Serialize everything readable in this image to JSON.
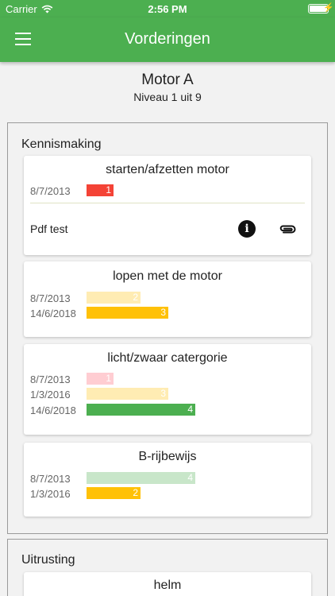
{
  "status": {
    "carrier": "Carrier",
    "time": "2:56 PM"
  },
  "appbar": {
    "title": "Vorderingen",
    "menu_icon": "menu-icon"
  },
  "header": {
    "title": "Motor A",
    "subtitle": "Niveau 1 uit 9"
  },
  "colors": {
    "primary": "#4caf50",
    "red": "#f44336",
    "pink_faded": "#ffcdd2",
    "amber": "#ffc107",
    "amber_faded": "#ffecb3",
    "green": "#4caf50",
    "green_faded": "#c8e6c9"
  },
  "sections": [
    {
      "title": "Kennismaking",
      "cards": [
        {
          "title": "starten/afzetten motor",
          "rows": [
            {
              "date": "8/7/2013",
              "value": "1"
            }
          ],
          "attachment": {
            "name": "Pdf test",
            "info_icon": "info-icon",
            "attach_icon": "paperclip-icon"
          }
        },
        {
          "title": "lopen met de motor",
          "rows": [
            {
              "date": "8/7/2013",
              "value": "2"
            },
            {
              "date": "14/6/2018",
              "value": "3"
            }
          ]
        },
        {
          "title": "licht/zwaar catergorie",
          "rows": [
            {
              "date": "8/7/2013",
              "value": "1"
            },
            {
              "date": "1/3/2016",
              "value": "3"
            },
            {
              "date": "14/6/2018",
              "value": "4"
            }
          ]
        },
        {
          "title": "B-rijbewijs",
          "rows": [
            {
              "date": "8/7/2013",
              "value": "4"
            },
            {
              "date": "1/3/2016",
              "value": "2"
            }
          ]
        }
      ]
    },
    {
      "title": "Uitrusting",
      "cards": [
        {
          "title": "helm"
        }
      ]
    }
  ]
}
